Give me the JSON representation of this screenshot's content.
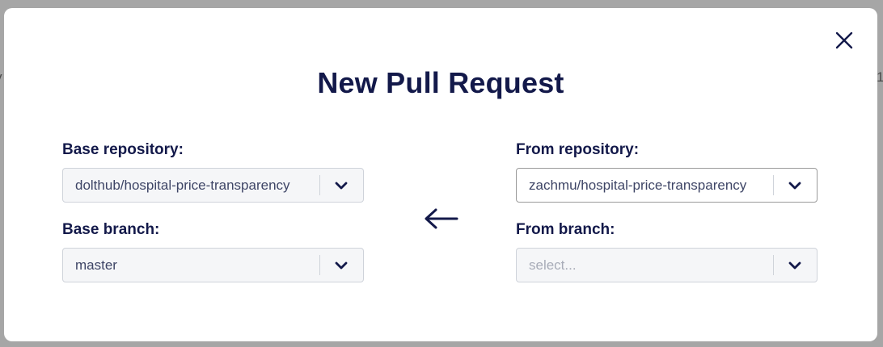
{
  "background": {
    "left_fragment": "y",
    "right_fragment": "1"
  },
  "modal": {
    "title": "New Pull Request",
    "close_icon": "close-icon"
  },
  "base": {
    "repo_label": "Base repository:",
    "repo_value": "dolthub/hospital-price-transparency",
    "branch_label": "Base branch:",
    "branch_value": "master"
  },
  "from": {
    "repo_label": "From repository:",
    "repo_value": "zachmu/hospital-price-transparency",
    "branch_label": "From branch:",
    "branch_placeholder": "select..."
  },
  "icons": {
    "direction": "arrow-left-icon",
    "dropdown": "chevron-down-icon"
  },
  "colors": {
    "primary": "#13194a",
    "input_bg": "#f5f6f8",
    "input_border": "#cfd3da",
    "placeholder": "#a8acb8"
  }
}
